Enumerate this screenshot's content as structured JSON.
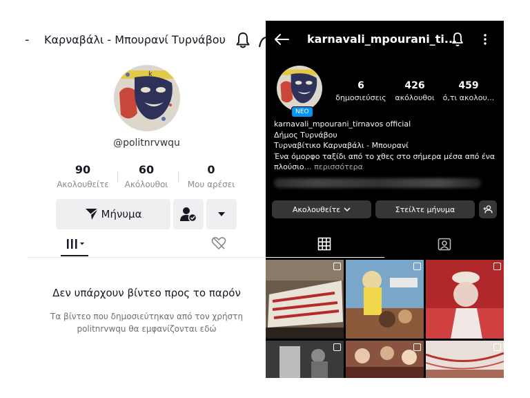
{
  "tiktok": {
    "back_glyph": "-",
    "title": "Καρναβάλι - Μπουρανί Τυρνάβου",
    "username": "@politnrvwqu",
    "stats": [
      {
        "value": "90",
        "label": "Ακολουθείτε"
      },
      {
        "value": "60",
        "label": "Ακόλουθοι"
      },
      {
        "value": "0",
        "label": "Μου αρέσει"
      }
    ],
    "message_button": "Μήνυμα",
    "empty_title": "Δεν υπάρχουν βίντεο προς το παρόν",
    "empty_desc_line1": "Τα βίντεο που δημοσιεύτηκαν από τον χρήστη",
    "empty_desc_line2": "politnrvwqu θα εμφανίζονται εδώ",
    "icons": [
      "bell-icon",
      "share-icon",
      "send-icon",
      "friend-check-icon",
      "caret-down-icon",
      "videos-grid-icon",
      "liked-hidden-icon"
    ]
  },
  "instagram": {
    "username": "karnavali_mpourani_ti...",
    "new_badge": "ΝΕΟ",
    "stats": [
      {
        "value": "6",
        "label": "δημοσιεύσεις"
      },
      {
        "value": "426",
        "label": "ακόλουθοι"
      },
      {
        "value": "459",
        "label": "ό,τι ακολου..."
      }
    ],
    "bio": {
      "name": "karnavali_mpourani_tirnavos official",
      "line1": "Δήμος Τυρνάβου",
      "line2": "Τυρναβίτικο Καρναβάλι - Μπουρανί",
      "line3": "Ένα όμορφο ταξίδι από το χθες στο σήμερα μέσα από ένα",
      "line4": "πλούσιο",
      "more": "… περισσότερα"
    },
    "following_button": "Ακολουθείτε",
    "message_button": "Στείλτε μήνυμα",
    "icons": [
      "back-arrow-icon",
      "bell-icon",
      "more-vertical-icon",
      "grid-icon",
      "tagged-icon",
      "add-person-icon"
    ]
  },
  "colors": {
    "tiktok_text": "#161823",
    "tiktok_button_bg": "#efeff1",
    "instagram_bg": "#000000",
    "instagram_button_bg": "#363636",
    "instagram_badge": "#0095f6"
  }
}
